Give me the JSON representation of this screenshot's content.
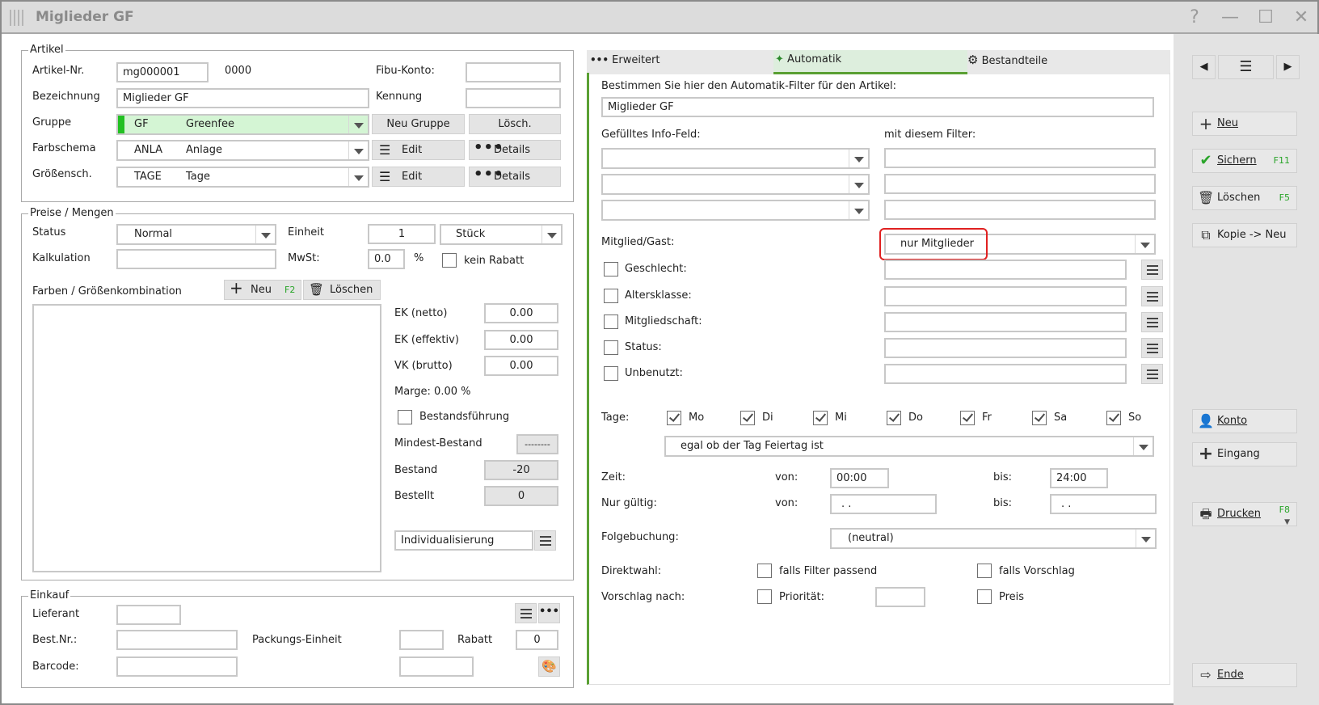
{
  "window": {
    "title": "Miglieder GF",
    "help": "?",
    "minimize": "—",
    "maximize": "☐",
    "close": "✕"
  },
  "artikel": {
    "legend": "Artikel",
    "nr_label": "Artikel-Nr.",
    "nr_value": "mg000001",
    "nr_extra": "0000",
    "fibu_label": "Fibu-Konto:",
    "fibu_value": "",
    "bez_label": "Bezeichnung",
    "bez_value": "Miglieder GF",
    "kennung_label": "Kennung",
    "kennung_value": "",
    "gruppe_label": "Gruppe",
    "gruppe_code": "GF",
    "gruppe_name": "Greenfee",
    "neu_gruppe": "Neu Gruppe",
    "loesch": "Lösch.",
    "farb_label": "Farbschema",
    "farb_code": "ANLA",
    "farb_name": "Anlage",
    "edit": "Edit",
    "details": "Details",
    "groess_label": "Größensch.",
    "groess_code": "TAGE",
    "groess_name": "Tage"
  },
  "preise": {
    "legend": "Preise / Mengen",
    "status_label": "Status",
    "status_value": "Normal",
    "einheit_label": "Einheit",
    "einheit_value": "1",
    "einheit_unit": "Stück",
    "kalk_label": "Kalkulation",
    "kalk_value": "",
    "mwst_label": "MwSt:",
    "mwst_value": "0.0",
    "percent": "%",
    "kein_rabatt": "kein Rabatt",
    "farben_label": "Farben / Größenkombination",
    "neu": "Neu",
    "neu_hk": "F2",
    "loeschen": "Löschen",
    "ek_netto_label": "EK (netto)",
    "ek_netto": "0.00",
    "ek_eff_label": "EK (effektiv)",
    "ek_eff": "0.00",
    "vk_label": "VK (brutto)",
    "vk": "0.00",
    "marge": "Marge: 0.00 %",
    "bestand_fuehrung": "Bestandsführung",
    "mindest_label": "Mindest-Bestand",
    "mindest": "--------",
    "bestand_label": "Bestand",
    "bestand": "-20",
    "bestellt_label": "Bestellt",
    "bestellt": "0",
    "individual": "Individualisierung"
  },
  "einkauf": {
    "legend": "Einkauf",
    "lieferant_label": "Lieferant",
    "lieferant": "",
    "bestnr_label": "Best.Nr.:",
    "bestnr": "",
    "pack_label": "Packungs-Einheit",
    "pack": "",
    "rabatt_label": "Rabatt",
    "rabatt": "0",
    "barcode_label": "Barcode:",
    "barcode": ""
  },
  "tabs": {
    "t1": "Erweitert",
    "t2": "Automatik",
    "t3": "Bestandteile"
  },
  "auto": {
    "intro": "Bestimmen Sie hier den Automatik-Filter für den Artikel:",
    "filter_name": "Miglieder GF",
    "info_label": "Gefülltes Info-Feld:",
    "filter_label": "mit diesem Filter:",
    "mg_label": "Mitglied/Gast:",
    "mg_value": "nur Mitglieder",
    "geschlecht": "Geschlecht:",
    "alter": "Altersklasse:",
    "mitglied": "Mitgliedschaft:",
    "status": "Status:",
    "unbenutzt": "Unbenutzt:",
    "tage_label": "Tage:",
    "days": [
      "Mo",
      "Di",
      "Mi",
      "Do",
      "Fr",
      "Sa",
      "So"
    ],
    "feiertag": "egal ob der Tag Feiertag ist",
    "zeit_label": "Zeit:",
    "von": "von:",
    "bis": "bis:",
    "zeit_von": "00:00",
    "zeit_bis": "24:00",
    "gueltig_label": "Nur gültig:",
    "gueltig_von": ". .",
    "gueltig_bis": ". .",
    "folge_label": "Folgebuchung:",
    "folge_value": "(neutral)",
    "direkt_label": "Direktwahl:",
    "falls_filter": "falls Filter passend",
    "falls_vorschlag": "falls Vorschlag",
    "vorschlag_label": "Vorschlag nach:",
    "prioritaet": "Priorität:",
    "preis": "Preis"
  },
  "side": {
    "neu": "Neu",
    "sichern": "Sichern",
    "sichern_hk": "F11",
    "loeschen": "Löschen",
    "loeschen_hk": "F5",
    "kopie": "Kopie -> Neu",
    "konto": "Konto",
    "eingang": "Eingang",
    "drucken": "Drucken",
    "drucken_hk": "F8",
    "ende": "Ende"
  },
  "colors": {
    "accent_green": "#5aa033",
    "highlight_red": "#e02020",
    "group_bg": "#d4f5d4"
  }
}
